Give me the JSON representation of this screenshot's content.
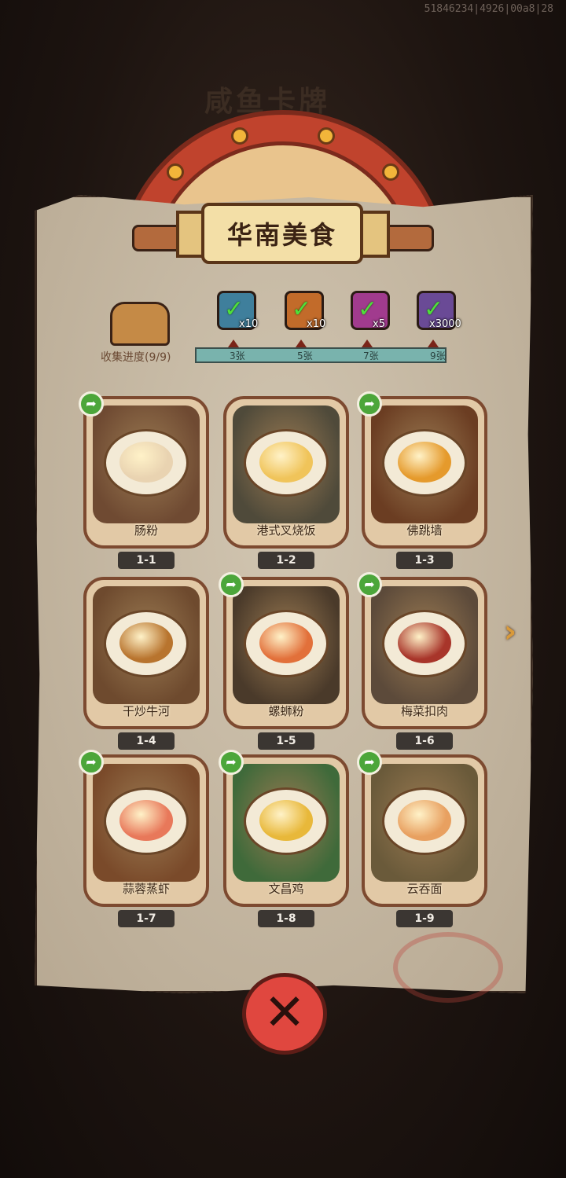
{
  "debug_id": "51846234|4926|00a8|28",
  "background_title": "咸鱼卡牌",
  "panel_title": "华南美食",
  "collection": {
    "label": "收集进度(9/9)",
    "collected": 9,
    "total": 9
  },
  "rewards": [
    {
      "icon": "treasure-chest-icon",
      "count": "x10",
      "color": "#3f7f9c",
      "claimed": true,
      "milestone": "3张"
    },
    {
      "icon": "key-icon",
      "count": "x10",
      "color": "#c26b2a",
      "claimed": true,
      "milestone": "5张"
    },
    {
      "icon": "gem-icon",
      "count": "x5",
      "color": "#a13b8e",
      "claimed": true,
      "milestone": "7张"
    },
    {
      "icon": "ore-icon",
      "count": "x3000",
      "color": "#6a4a96",
      "claimed": true,
      "milestone": "9张"
    }
  ],
  "cards": [
    {
      "id": "1-1",
      "name": "肠粉",
      "shareable": true,
      "art": "#6f4a32",
      "food": "#e9d3b1"
    },
    {
      "id": "1-2",
      "name": "港式叉烧饭",
      "shareable": false,
      "art": "#4f4a3a",
      "food": "#f0c45a"
    },
    {
      "id": "1-3",
      "name": "佛跳墙",
      "shareable": true,
      "art": "#6b3d22",
      "food": "#e59a2c"
    },
    {
      "id": "1-4",
      "name": "干炒牛河",
      "shareable": false,
      "art": "#6e4a2e",
      "food": "#b8742e"
    },
    {
      "id": "1-5",
      "name": "螺蛳粉",
      "shareable": true,
      "art": "#4a3a2a",
      "food": "#e2703a"
    },
    {
      "id": "1-6",
      "name": "梅菜扣肉",
      "shareable": true,
      "art": "#5c4a3a",
      "food": "#a8352a"
    },
    {
      "id": "1-7",
      "name": "蒜蓉蒸虾",
      "shareable": true,
      "art": "#7a4a2a",
      "food": "#e8785a"
    },
    {
      "id": "1-8",
      "name": "文昌鸡",
      "shareable": true,
      "art": "#3f6a3a",
      "food": "#e8b83a"
    },
    {
      "id": "1-9",
      "name": "云吞面",
      "shareable": true,
      "art": "#6a5a3a",
      "food": "#e8a060"
    }
  ],
  "icons": {
    "share": "share-arrow-icon",
    "next": "next-page-arrow-icon",
    "close": "close-icon"
  },
  "colors": {
    "accent_red": "#e0473f",
    "progress_teal": "#79b3ad",
    "paper": "#c9bba3",
    "share_green": "#4ca63a"
  }
}
